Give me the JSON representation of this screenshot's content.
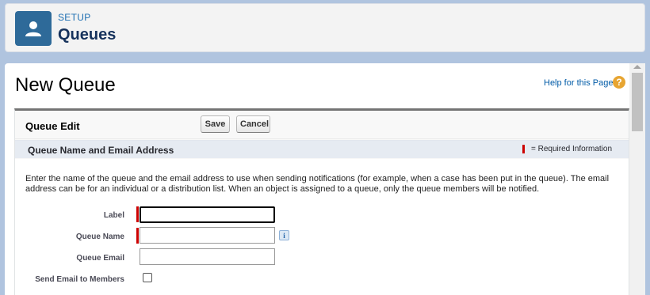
{
  "header": {
    "setup_label": "SETUP",
    "title": "Queues",
    "icon": "queue-user-icon"
  },
  "page": {
    "title": "New Queue",
    "help_link": "Help for this Page",
    "help_icon": "question-icon"
  },
  "block": {
    "title": "Queue Edit",
    "save_label": "Save",
    "cancel_label": "Cancel"
  },
  "section": {
    "title": "Queue Name and Email Address",
    "required_info": "= Required Information",
    "intro": "Enter the name of the queue and the email address to use when sending notifications (for example, when a case has been put in the queue). The email address can be for an individual or a distribution list. When an object is assigned to a queue, only the queue members will be notified."
  },
  "fields": {
    "label": {
      "label": "Label",
      "value": "",
      "required": true
    },
    "queue_name": {
      "label": "Queue Name",
      "value": "",
      "required": true
    },
    "queue_email": {
      "label": "Queue Email",
      "value": "",
      "required": false
    },
    "send_email": {
      "label": "Send Email to Members",
      "checked": false
    }
  },
  "colors": {
    "accent": "#2e6a99",
    "link": "#015ba7",
    "required": "#cc0000",
    "help": "#e7a532"
  }
}
